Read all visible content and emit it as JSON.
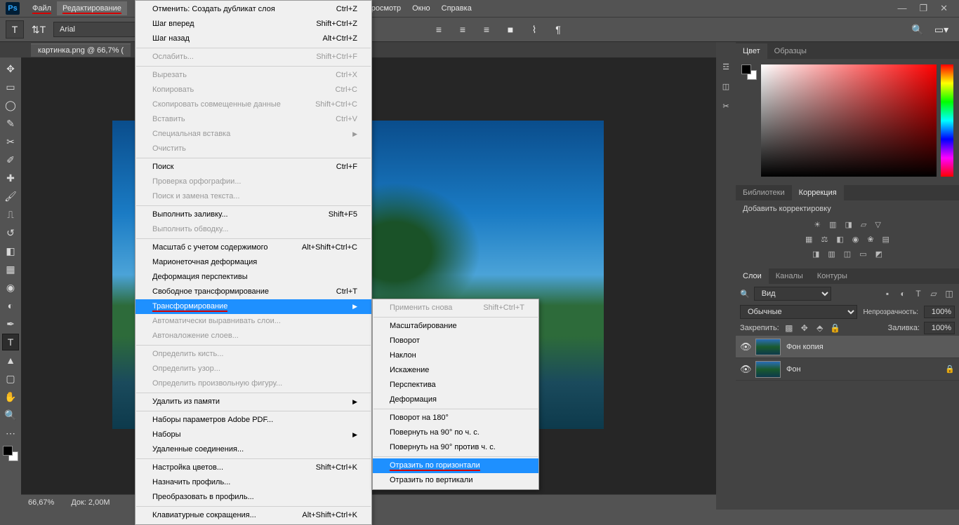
{
  "app": {
    "logo": "Ps"
  },
  "menubar": {
    "items": [
      "Файл",
      "Редактирование",
      "Просмотр",
      "Окно",
      "Справка"
    ],
    "active_index": 1
  },
  "window_controls": {
    "min": "—",
    "max": "❐",
    "close": "✕"
  },
  "optionsbar": {
    "font": "Arial",
    "align_icons": [
      "≡",
      "≡",
      "≡"
    ]
  },
  "doctab": "картинка.png @ 66,7% (",
  "edit_menu": {
    "groups": [
      [
        {
          "label": "Отменить: Создать дубликат слоя",
          "shortcut": "Ctrl+Z",
          "disabled": false
        },
        {
          "label": "Шаг вперед",
          "shortcut": "Shift+Ctrl+Z",
          "disabled": false
        },
        {
          "label": "Шаг назад",
          "shortcut": "Alt+Ctrl+Z",
          "disabled": false
        }
      ],
      [
        {
          "label": "Ослабить...",
          "shortcut": "Shift+Ctrl+F",
          "disabled": true
        }
      ],
      [
        {
          "label": "Вырезать",
          "shortcut": "Ctrl+X",
          "disabled": true
        },
        {
          "label": "Копировать",
          "shortcut": "Ctrl+C",
          "disabled": true
        },
        {
          "label": "Скопировать совмещенные данные",
          "shortcut": "Shift+Ctrl+C",
          "disabled": true
        },
        {
          "label": "Вставить",
          "shortcut": "Ctrl+V",
          "disabled": true
        },
        {
          "label": "Специальная вставка",
          "shortcut": "",
          "disabled": true,
          "submenu": true
        },
        {
          "label": "Очистить",
          "shortcut": "",
          "disabled": true
        }
      ],
      [
        {
          "label": "Поиск",
          "shortcut": "Ctrl+F",
          "disabled": false
        },
        {
          "label": "Проверка орфографии...",
          "shortcut": "",
          "disabled": true
        },
        {
          "label": "Поиск и замена текста...",
          "shortcut": "",
          "disabled": true
        }
      ],
      [
        {
          "label": "Выполнить заливку...",
          "shortcut": "Shift+F5",
          "disabled": false
        },
        {
          "label": "Выполнить обводку...",
          "shortcut": "",
          "disabled": true
        }
      ],
      [
        {
          "label": "Масштаб с учетом содержимого",
          "shortcut": "Alt+Shift+Ctrl+C",
          "disabled": false
        },
        {
          "label": "Марионеточная деформация",
          "shortcut": "",
          "disabled": false
        },
        {
          "label": "Деформация перспективы",
          "shortcut": "",
          "disabled": false
        },
        {
          "label": "Свободное трансформирование",
          "shortcut": "Ctrl+T",
          "disabled": false
        },
        {
          "label": "Трансформирование",
          "shortcut": "",
          "disabled": false,
          "submenu": true,
          "highlighted": true
        },
        {
          "label": "Автоматически выравнивать слои...",
          "shortcut": "",
          "disabled": true
        },
        {
          "label": "Автоналожение слоев...",
          "shortcut": "",
          "disabled": true
        }
      ],
      [
        {
          "label": "Определить кисть...",
          "shortcut": "",
          "disabled": true
        },
        {
          "label": "Определить узор...",
          "shortcut": "",
          "disabled": true
        },
        {
          "label": "Определить произвольную фигуру...",
          "shortcut": "",
          "disabled": true
        }
      ],
      [
        {
          "label": "Удалить из памяти",
          "shortcut": "",
          "disabled": false,
          "submenu": true
        }
      ],
      [
        {
          "label": "Наборы параметров Adobe PDF...",
          "shortcut": "",
          "disabled": false
        },
        {
          "label": "Наборы",
          "shortcut": "",
          "disabled": false,
          "submenu": true
        },
        {
          "label": "Удаленные соединения...",
          "shortcut": "",
          "disabled": false
        }
      ],
      [
        {
          "label": "Настройка цветов...",
          "shortcut": "Shift+Ctrl+K",
          "disabled": false
        },
        {
          "label": "Назначить профиль...",
          "shortcut": "",
          "disabled": false
        },
        {
          "label": "Преобразовать в профиль...",
          "shortcut": "",
          "disabled": false
        }
      ],
      [
        {
          "label": "Клавиатурные сокращения...",
          "shortcut": "Alt+Shift+Ctrl+K",
          "disabled": false
        }
      ]
    ]
  },
  "transform_submenu": {
    "groups": [
      [
        {
          "label": "Применить снова",
          "shortcut": "Shift+Ctrl+T",
          "disabled": true
        }
      ],
      [
        {
          "label": "Масштабирование",
          "disabled": false
        },
        {
          "label": "Поворот",
          "disabled": false
        },
        {
          "label": "Наклон",
          "disabled": false
        },
        {
          "label": "Искажение",
          "disabled": false
        },
        {
          "label": "Перспектива",
          "disabled": false
        },
        {
          "label": "Деформация",
          "disabled": false
        }
      ],
      [
        {
          "label": "Поворот на 180°",
          "disabled": false
        },
        {
          "label": "Повернуть на 90° по ч. с.",
          "disabled": false
        },
        {
          "label": "Повернуть на 90° против ч. с.",
          "disabled": false
        }
      ],
      [
        {
          "label": "Отразить по горизонтали",
          "disabled": false,
          "highlighted": true
        },
        {
          "label": "Отразить по вертикали",
          "disabled": false
        }
      ]
    ]
  },
  "panels": {
    "color": {
      "tabs": [
        "Цвет",
        "Образцы"
      ],
      "active": 0
    },
    "lib": {
      "tabs": [
        "Библиотеки",
        "Коррекция"
      ],
      "active": 1,
      "title": "Добавить корректировку"
    },
    "layers": {
      "tabs": [
        "Слои",
        "Каналы",
        "Контуры"
      ],
      "active": 0,
      "kind": "Вид",
      "blend": "Обычные",
      "opacity_label": "Непрозрачность:",
      "opacity": "100%",
      "lock_label": "Закрепить:",
      "fill_label": "Заливка:",
      "fill": "100%",
      "items": [
        {
          "name": "Фон копия",
          "locked": false,
          "selected": true
        },
        {
          "name": "Фон",
          "locked": true,
          "selected": false
        }
      ]
    }
  },
  "status": {
    "zoom": "66,67%",
    "doc": "Док: 2,00M"
  },
  "search_placeholder": "Вид"
}
